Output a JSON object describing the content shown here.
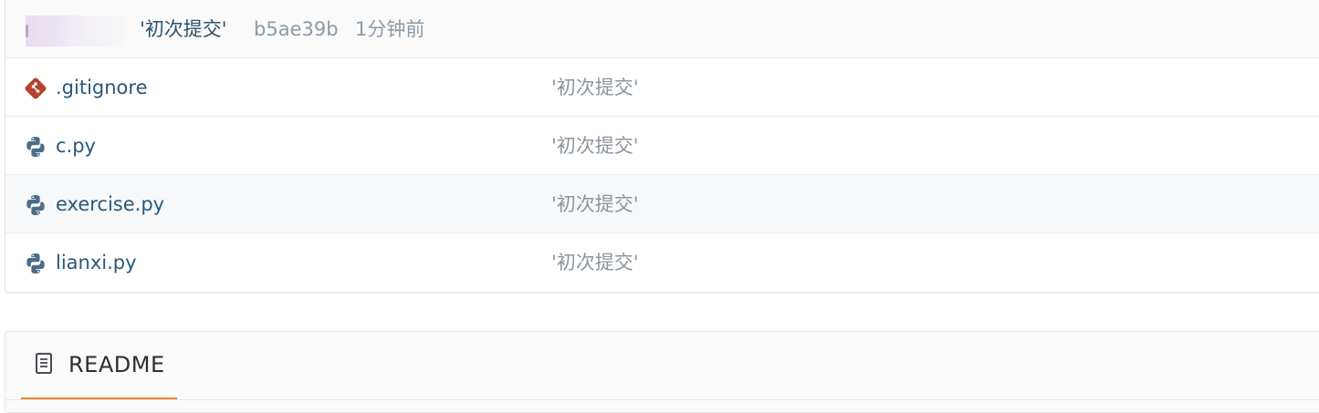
{
  "latest_commit": {
    "message": "'初次提交'",
    "hash": "b5ae39b",
    "time": "1分钟前"
  },
  "files": [
    {
      "name": ".gitignore",
      "icon": "git-icon",
      "commit": "'初次提交'"
    },
    {
      "name": "c.py",
      "icon": "python-icon",
      "commit": "'初次提交'"
    },
    {
      "name": "exercise.py",
      "icon": "python-icon",
      "commit": "'初次提交'"
    },
    {
      "name": "lianxi.py",
      "icon": "python-icon",
      "commit": "'初次提交'"
    }
  ],
  "readme": {
    "tab_label": "README",
    "icon": "document-icon",
    "accent_color": "#e8832a"
  },
  "colors": {
    "link": "#2c5878",
    "muted": "#8c959d",
    "git_icon": "#b5432f",
    "python_icon": "#4d6c86"
  }
}
